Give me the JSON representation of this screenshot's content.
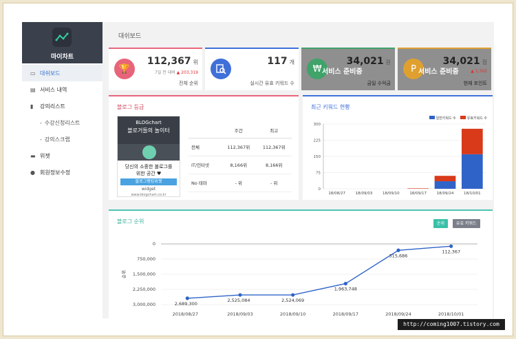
{
  "sidebar": {
    "brand_name": "마이차트",
    "items": [
      {
        "label": "대쉬보드",
        "icon": "monitor-icon",
        "active": true
      },
      {
        "label": "서비스 내역",
        "icon": "list-icon"
      },
      {
        "label": "강의리스트",
        "icon": "book-icon"
      },
      {
        "label": "수강신청리스트",
        "sub": true
      },
      {
        "label": "강의스크랩",
        "sub": true
      },
      {
        "label": "위젯",
        "icon": "widget-icon"
      },
      {
        "label": "회원정보수정",
        "icon": "user-icon"
      }
    ]
  },
  "page_title": "대쉬보드",
  "stats": {
    "rank": {
      "value": "112,367",
      "unit": "위",
      "sub_prefix": "7일 전 대비",
      "sub_delta": "▲ 203,319",
      "label": "전체 순위",
      "color": "#e8647a"
    },
    "keywords": {
      "value": "117",
      "unit": "개",
      "label": "실시간 유효 키워드 수",
      "color": "#3f6fd8"
    },
    "revenue": {
      "value": "34,021",
      "unit": "원",
      "label": "금일 수익금",
      "overlay": "서비스 준비중",
      "color": "#3fa36a"
    },
    "points": {
      "value": "34,021",
      "unit": "점",
      "sub_delta": "▲ 1,302",
      "label": "현재 포인트",
      "overlay": "서비스 준비중",
      "color": "#e0a030"
    }
  },
  "blog_grade": {
    "title": "블로그 등급",
    "widget": {
      "logo": "BLOGchart",
      "headline": "블로거들의 놀이터",
      "message_line1": "당신의 소중한 블로그를",
      "message_line2": "위한 공간 ♥",
      "rank_button": "블로그랭킹위젯",
      "label": "widget",
      "url": "www.blogchart.co.kr"
    },
    "table": {
      "headers": [
        "",
        "주간",
        "최고"
      ],
      "rows": [
        [
          "전체",
          "112,367위",
          "112,367위"
        ],
        [
          "IT/인터넷",
          "8,166위",
          "8,166위"
        ],
        [
          "No 테마",
          "- 위",
          "- 위"
        ]
      ]
    }
  },
  "keyword_chart_title": "최근 키워드 현황",
  "rank_chart_title": "블로그 순위",
  "buttons": {
    "rank": "순위",
    "keywords": "유효 키워드"
  },
  "watermark": "http://coming1007.tistory.com",
  "chart_data": [
    {
      "type": "bar",
      "title": "최근 키워드 현황",
      "categories": [
        "18/08/27",
        "18/09/03",
        "18/09/10",
        "18/09/17",
        "18/09/24",
        "18/10/01"
      ],
      "series": [
        {
          "name": "일반키워드 수",
          "values": [
            0,
            0,
            0,
            0,
            35,
            160
          ],
          "color": "#2f63c8"
        },
        {
          "name": "유효키워드 수",
          "values": [
            0,
            0,
            0,
            2,
            25,
            118
          ],
          "color": "#d83a1a"
        }
      ],
      "stacked": true,
      "yticks": [
        0,
        75,
        150,
        225,
        300
      ],
      "ylim": [
        0,
        300
      ],
      "legend": "top-right",
      "grid": true
    },
    {
      "type": "line",
      "title": "블로그 순위",
      "ylabel": "순위",
      "categories": [
        "2018/08/27",
        "2018/09/03",
        "2018/09/10",
        "2018/09/17",
        "2018/09/24",
        "2018/10/01"
      ],
      "series": [
        {
          "name": "순위",
          "values": [
            2689300,
            2525084,
            2524069,
            1963748,
            315686,
            112367
          ],
          "labels": [
            "2,689,300",
            "2,525,084",
            "2,524,069",
            "1,963,748",
            "315,686",
            "112,367"
          ],
          "color": "#2f63c8"
        }
      ],
      "yticks": [
        "0",
        "750,000",
        "1,500,000",
        "2,250,000",
        "3,000,000"
      ],
      "ylim": [
        0,
        3000000
      ],
      "inverted": true,
      "grid": true
    }
  ]
}
